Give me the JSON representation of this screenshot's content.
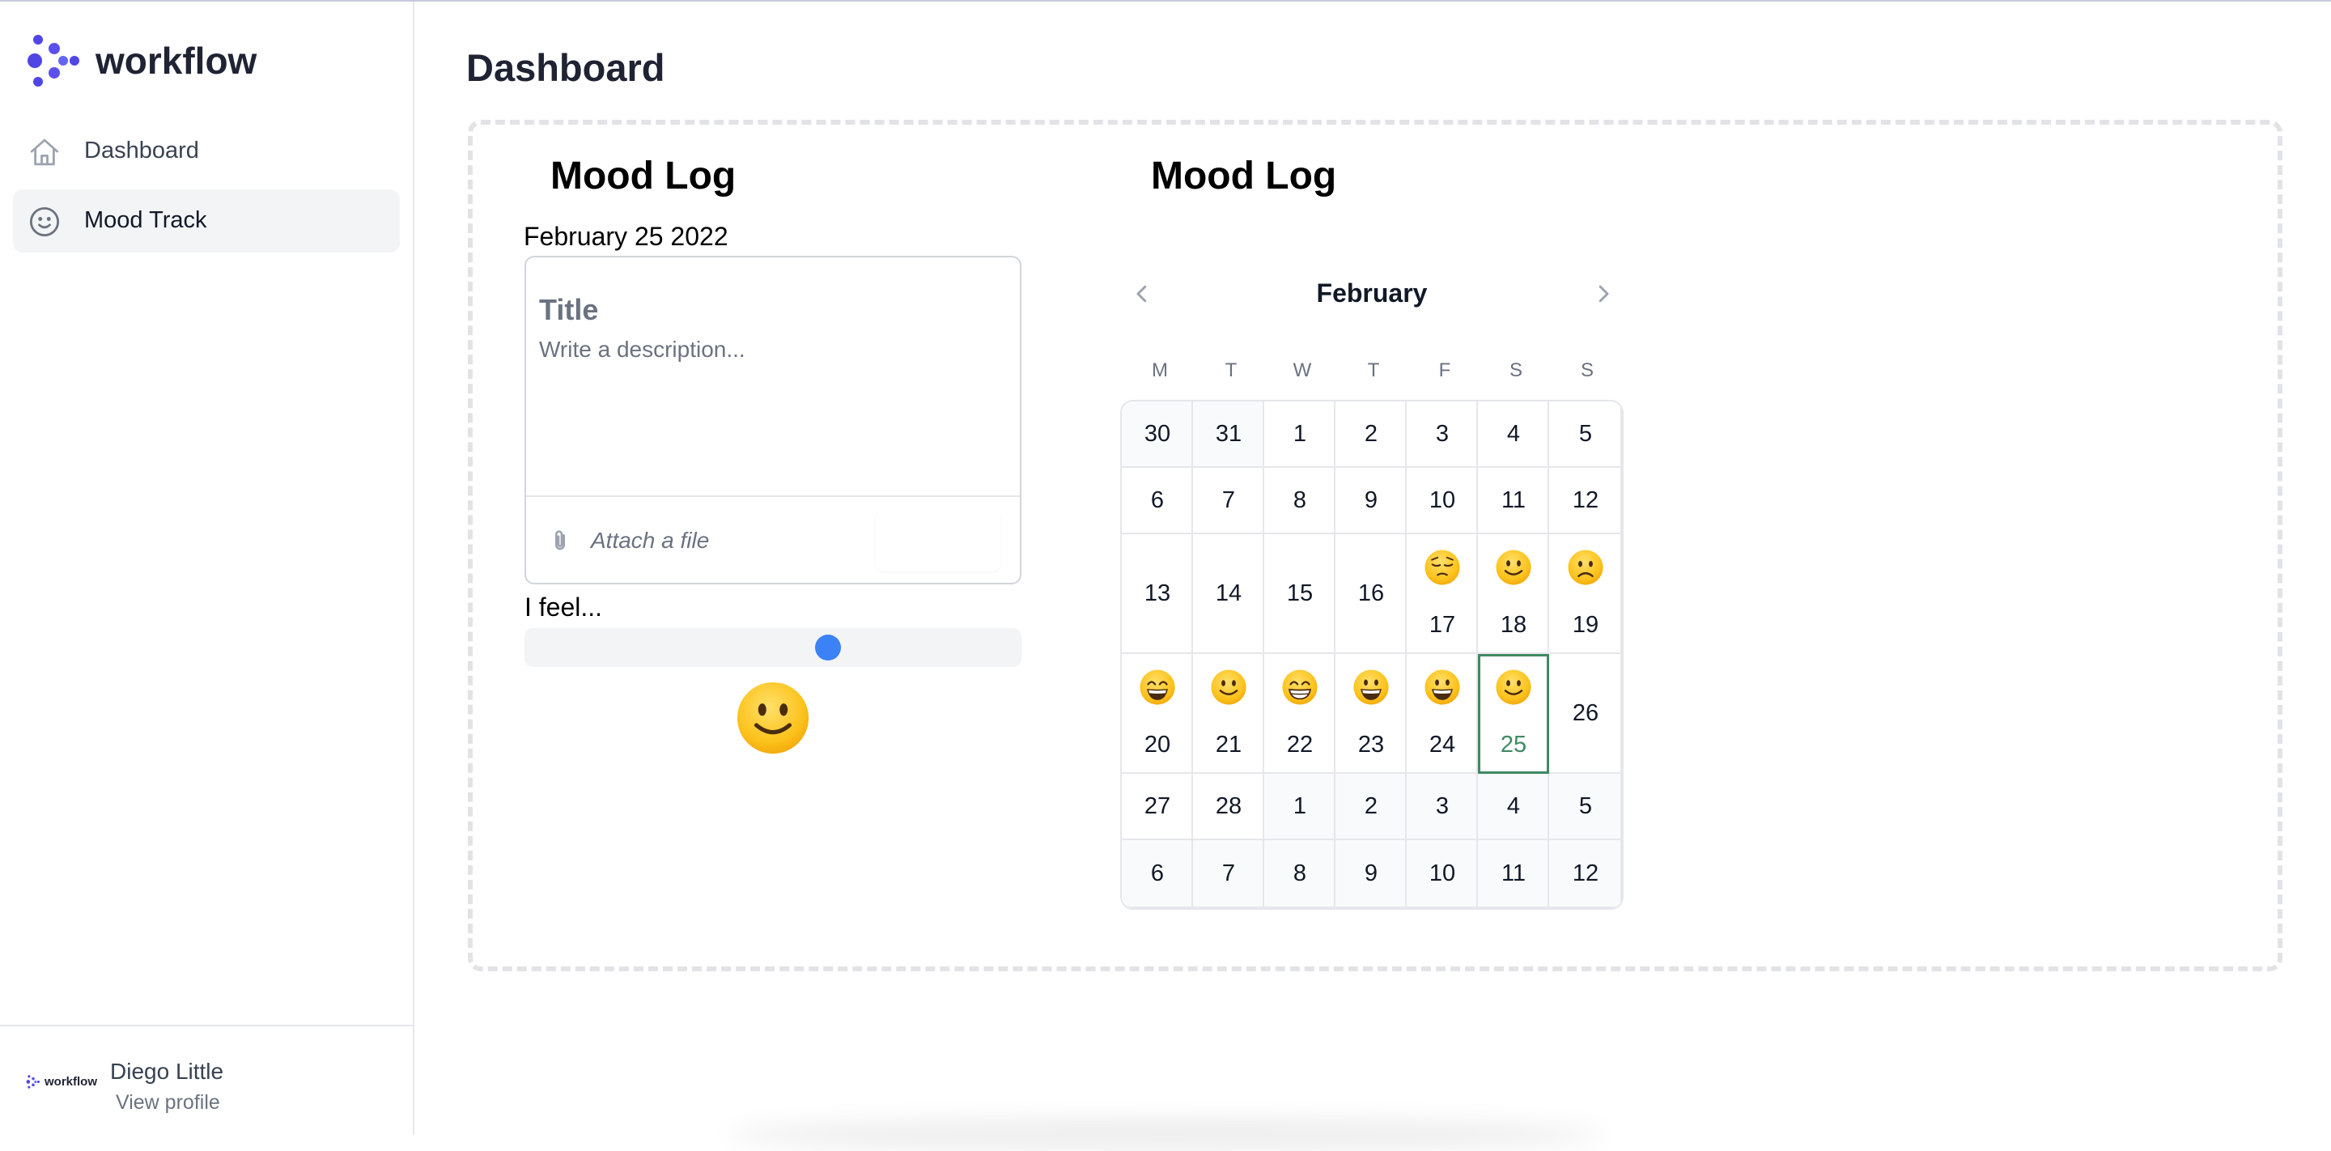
{
  "sidebar": {
    "brand": "workflow",
    "items": [
      {
        "label": "Dashboard",
        "icon": "home-icon",
        "active": false
      },
      {
        "label": "Mood Track",
        "icon": "smiley-icon",
        "active": true
      }
    ],
    "footer": {
      "brand": "workflow",
      "user_name": "Diego Little",
      "view_profile": "View profile"
    }
  },
  "main": {
    "page_title": "Dashboard",
    "mood_log_form": {
      "title": "Mood Log",
      "date": "February 25 2022",
      "title_placeholder": "Title",
      "description_placeholder": "Write a description...",
      "attach_label": "Attach a file",
      "feel_label": "I feel...",
      "slider_value_fraction": 0.62,
      "current_mood_icon": "slightly-smiling-face"
    },
    "calendar": {
      "title": "Mood Log",
      "month": "February",
      "weekdays": [
        "M",
        "T",
        "W",
        "T",
        "F",
        "S",
        "S"
      ],
      "weeks": [
        [
          {
            "d": "30",
            "out": true
          },
          {
            "d": "31",
            "out": true
          },
          {
            "d": "1"
          },
          {
            "d": "2"
          },
          {
            "d": "3"
          },
          {
            "d": "4"
          },
          {
            "d": "5"
          }
        ],
        [
          {
            "d": "6"
          },
          {
            "d": "7"
          },
          {
            "d": "8"
          },
          {
            "d": "9"
          },
          {
            "d": "10"
          },
          {
            "d": "11"
          },
          {
            "d": "12"
          }
        ],
        [
          {
            "d": "13"
          },
          {
            "d": "14"
          },
          {
            "d": "15"
          },
          {
            "d": "16"
          },
          {
            "d": "17",
            "mood": "pensive"
          },
          {
            "d": "18",
            "mood": "smile"
          },
          {
            "d": "19",
            "mood": "frown"
          }
        ],
        [
          {
            "d": "20",
            "mood": "grin-smile"
          },
          {
            "d": "21",
            "mood": "smile"
          },
          {
            "d": "22",
            "mood": "grin"
          },
          {
            "d": "23",
            "mood": "grin-open"
          },
          {
            "d": "24",
            "mood": "grin-open"
          },
          {
            "d": "25",
            "mood": "smile",
            "selected": true
          },
          {
            "d": "26"
          }
        ],
        [
          {
            "d": "27"
          },
          {
            "d": "28"
          },
          {
            "d": "1",
            "out": true
          },
          {
            "d": "2",
            "out": true
          },
          {
            "d": "3",
            "out": true
          },
          {
            "d": "4",
            "out": true
          },
          {
            "d": "5",
            "out": true
          }
        ],
        [
          {
            "d": "6",
            "out": true
          },
          {
            "d": "7",
            "out": true
          },
          {
            "d": "8",
            "out": true
          },
          {
            "d": "9",
            "out": true
          },
          {
            "d": "10",
            "out": true
          },
          {
            "d": "11",
            "out": true
          },
          {
            "d": "12",
            "out": true
          }
        ]
      ],
      "accent_color": "#3f8a63"
    }
  },
  "colors": {
    "brand": "#4f46e5",
    "slider_thumb": "#3b82f6"
  }
}
